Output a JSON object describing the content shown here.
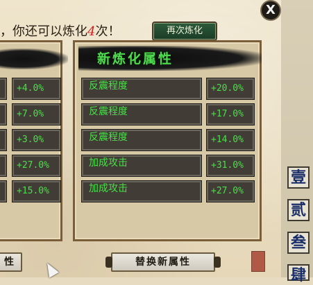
{
  "header": {
    "message_prefix": "，你还可以炼化",
    "remaining_count": "4",
    "message_suffix": "次！",
    "refine_again_label": "再次炼化"
  },
  "new_panel": {
    "title": "新炼化属性",
    "rows": [
      {
        "name": "反震程度",
        "value": "+20.0%"
      },
      {
        "name": "反震程度",
        "value": "+17.0%"
      },
      {
        "name": "反震程度",
        "value": "+14.0%"
      },
      {
        "name": "加成攻击",
        "value": "+31.0%"
      },
      {
        "name": "加成攻击",
        "value": "+27.0%"
      }
    ]
  },
  "old_panel": {
    "values": [
      "+4.0%",
      "+7.0%",
      "+3.0%",
      "+27.0%",
      "+15.0%"
    ]
  },
  "buttons": {
    "left_partial_label": "性",
    "replace_label": "替换新属性"
  },
  "side_tabs": [
    "壹",
    "贰",
    "叁",
    "肆"
  ],
  "close_label": "X",
  "colors": {
    "attr_text": "#48e048",
    "count_text": "#d02020",
    "row_bg": "#413d36"
  }
}
